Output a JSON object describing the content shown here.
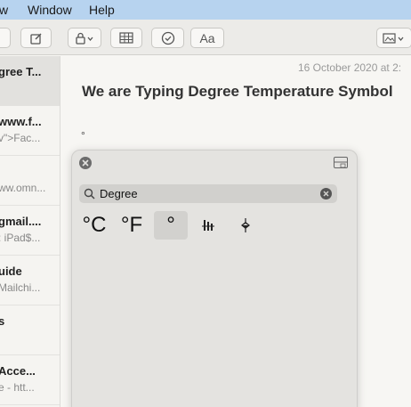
{
  "menubar": {
    "view_fragment": "w",
    "window": "Window",
    "help": "Help"
  },
  "toolbar": {
    "format_label": "Aa"
  },
  "sidebar": {
    "notes": [
      {
        "title": "gree T...",
        "subtitle": ""
      },
      {
        "title": "www.f...",
        "subtitle": "v\">Fac..."
      },
      {
        "title": "",
        "subtitle": "ww.omn..."
      },
      {
        "title": "gmail....",
        "subtitle": ": iPad$..."
      },
      {
        "title": "uide",
        "subtitle": "Mailchi..."
      },
      {
        "title": "s",
        "subtitle": ""
      },
      {
        "title": "Acce...",
        "subtitle": "e - htt..."
      }
    ]
  },
  "note": {
    "date": "16 October 2020 at 2:",
    "heading": "We are Typing Degree Temperature Symbol",
    "body_char": "°"
  },
  "character_viewer": {
    "search_value": "Degree",
    "results": [
      {
        "char": "°C"
      },
      {
        "char": "°F"
      },
      {
        "char": "°"
      },
      {
        "char": ""
      },
      {
        "char": ""
      }
    ]
  }
}
